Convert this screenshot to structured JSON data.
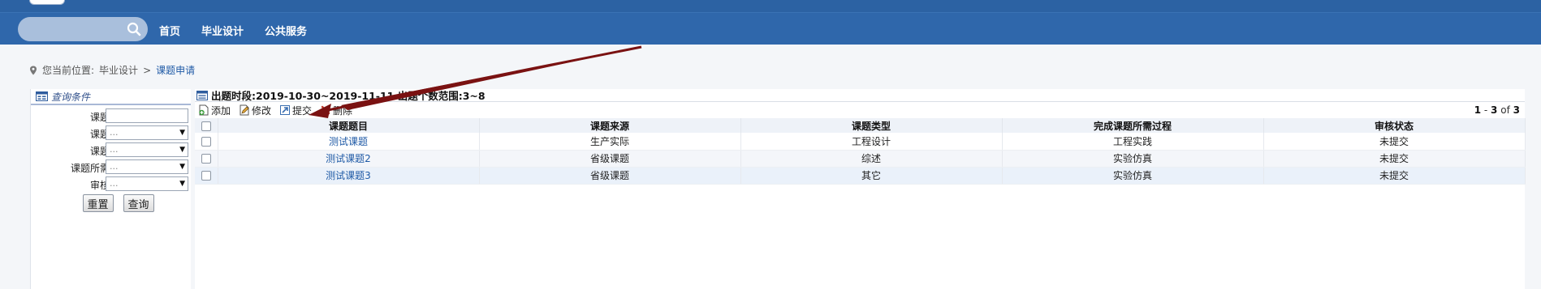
{
  "nav": {
    "items": [
      {
        "label": "首页"
      },
      {
        "label": "毕业设计"
      },
      {
        "label": "公共服务"
      }
    ]
  },
  "breadcrumb": {
    "prefix": "您当前位置:",
    "section": "毕业设计",
    "separator": ">",
    "current": "课题申请"
  },
  "query": {
    "title": "查询条件",
    "fields": [
      {
        "label": "课题题目:",
        "value": ""
      },
      {
        "label": "课题来源:",
        "value": "..."
      },
      {
        "label": "课题类型:",
        "value": "..."
      },
      {
        "label": "课题所需过程:",
        "value": "..."
      },
      {
        "label": "审核状态:",
        "value": "..."
      }
    ],
    "reset_label": "重置",
    "search_label": "查询"
  },
  "topic": {
    "period": "出题时段:2019-10-30~2019-11-11 出题个数范围:3~8"
  },
  "toolbar": {
    "add_label": "添加",
    "edit_label": "修改",
    "submit_label": "提交",
    "delete_label": "删除",
    "pager_from": "1",
    "pager_dash": "-",
    "pager_to": "3",
    "pager_of": "of",
    "pager_total": "3"
  },
  "table": {
    "columns": [
      "课题题目",
      "课题来源",
      "课题类型",
      "完成课题所需过程",
      "审核状态"
    ],
    "rows": [
      [
        "测试课题",
        "生产实际",
        "工程设计",
        "工程实践",
        "未提交"
      ],
      [
        "测试课题2",
        "省级课题",
        "综述",
        "实验仿真",
        "未提交"
      ],
      [
        "测试课题3",
        "省级课题",
        "其它",
        "实验仿真",
        "未提交"
      ]
    ]
  },
  "colors": {
    "header_bg": "#2f67ab",
    "link": "#1f5aa6",
    "annotation_arrow": "#7a1212"
  }
}
